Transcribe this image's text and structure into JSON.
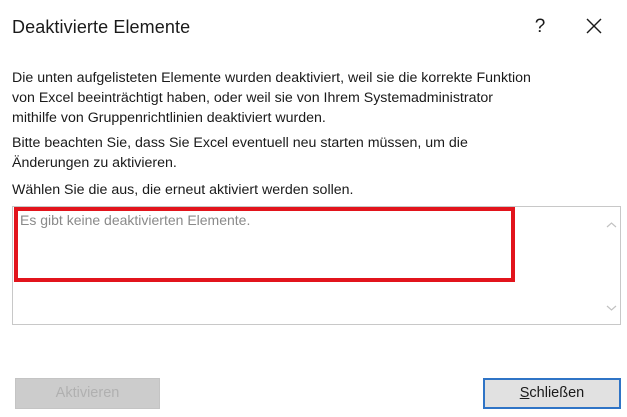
{
  "dialog": {
    "title": "Deaktivierte Elemente",
    "help_label": "?",
    "close_icon": "close-icon"
  },
  "description": {
    "paragraph1": "Die unten aufgelisteten Elemente wurden deaktiviert, weil sie die korrekte Funktion\nvon Excel beeinträchtigt haben, oder weil sie von Ihrem Systemadministrator\nmithilfe von Gruppenrichtlinien deaktiviert wurden.",
    "paragraph2": "Bitte beachten Sie, dass Sie Excel eventuell neu starten müssen, um die\nÄnderungen zu aktivieren.",
    "paragraph3": "Wählen Sie die aus, die erneut aktiviert werden sollen."
  },
  "list": {
    "empty_text": "Es gibt keine deaktivierten Elemente.",
    "scroll_up_icon": "chevron-up-icon",
    "scroll_down_icon": "chevron-down-icon"
  },
  "buttons": {
    "activate_label": "Aktivieren",
    "close_accel": "S",
    "close_rest": "chließen"
  },
  "colors": {
    "highlight": "#e2141c",
    "default_button_border": "#2f74c6",
    "disabled_button_bg": "#cccccc"
  }
}
